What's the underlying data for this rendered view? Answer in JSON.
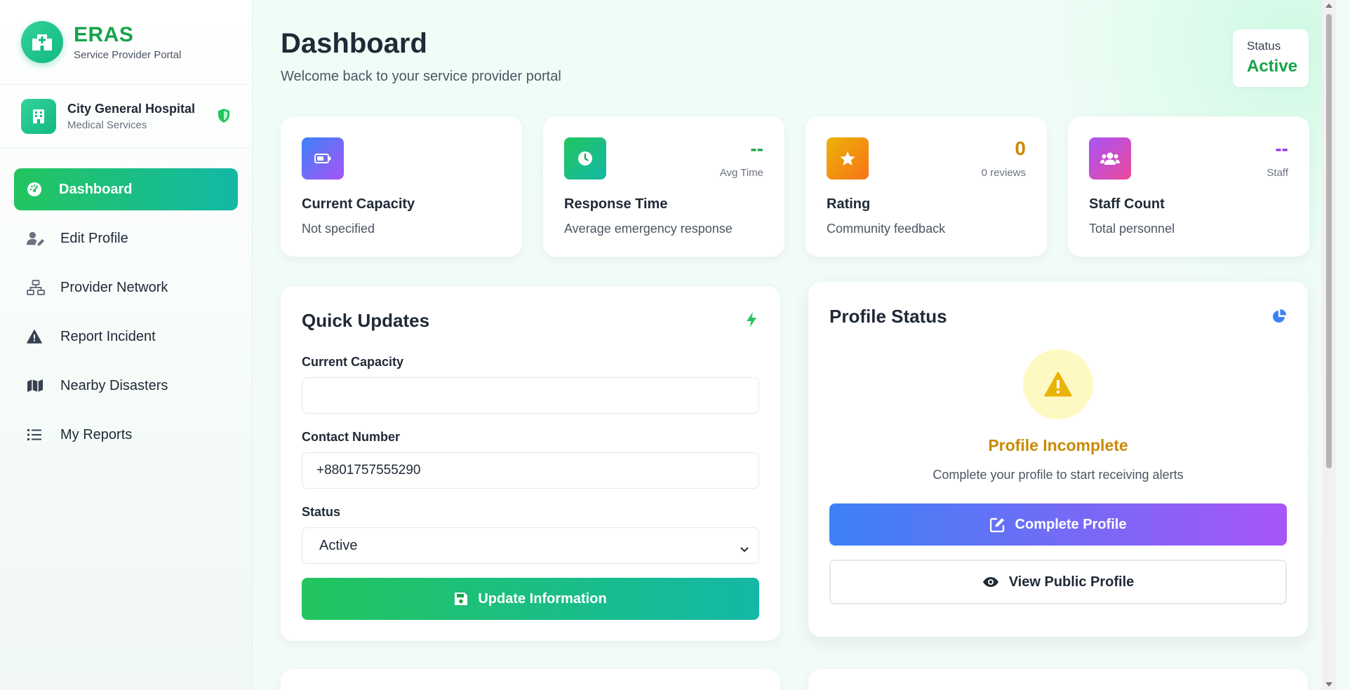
{
  "brand": {
    "title": "ERAS",
    "subtitle": "Service Provider Portal"
  },
  "organization": {
    "name": "City General Hospital",
    "type": "Medical Services"
  },
  "sidebar": {
    "items": [
      {
        "label": "Dashboard",
        "icon": "gauge-icon",
        "active": true
      },
      {
        "label": "Edit Profile",
        "icon": "user-edit-icon",
        "active": false
      },
      {
        "label": "Provider Network",
        "icon": "network-icon",
        "active": false
      },
      {
        "label": "Report Incident",
        "icon": "warning-icon",
        "active": false
      },
      {
        "label": "Nearby Disasters",
        "icon": "map-icon",
        "active": false
      },
      {
        "label": "My Reports",
        "icon": "list-icon",
        "active": false
      }
    ]
  },
  "header": {
    "title": "Dashboard",
    "subtitle": "Welcome back to your service provider portal",
    "status_label": "Status",
    "status_value": "Active"
  },
  "stats": [
    {
      "title": "Current Capacity",
      "desc": "Not specified",
      "value": "",
      "unit": "",
      "icon": "battery-icon",
      "color": "#6366f1"
    },
    {
      "title": "Response Time",
      "desc": "Average emergency response",
      "value": "--",
      "unit": "Avg Time",
      "icon": "clock-icon",
      "color": "#16a34a"
    },
    {
      "title": "Rating",
      "desc": "Community feedback",
      "value": "0",
      "unit": "0 reviews",
      "icon": "star-icon",
      "color": "#ca8a04"
    },
    {
      "title": "Staff Count",
      "desc": "Total personnel",
      "value": "--",
      "unit": "Staff",
      "icon": "users-icon",
      "color": "#9333ea"
    }
  ],
  "quick_updates": {
    "title": "Quick Updates",
    "capacity_label": "Current Capacity",
    "capacity_value": "",
    "contact_label": "Contact Number",
    "contact_value": "+8801757555290",
    "status_label": "Status",
    "status_value": "Active",
    "button": "Update Information"
  },
  "profile_status": {
    "title": "Profile Status",
    "state": "Profile Incomplete",
    "message": "Complete your profile to start receiving alerts",
    "complete_button": "Complete Profile",
    "view_button": "View Public Profile"
  },
  "colors": {
    "accent_green": "#22c55e",
    "accent_teal": "#14b8a6",
    "warning_yellow": "#ca8a04",
    "blue": "#3b82f6",
    "purple": "#a855f7"
  }
}
